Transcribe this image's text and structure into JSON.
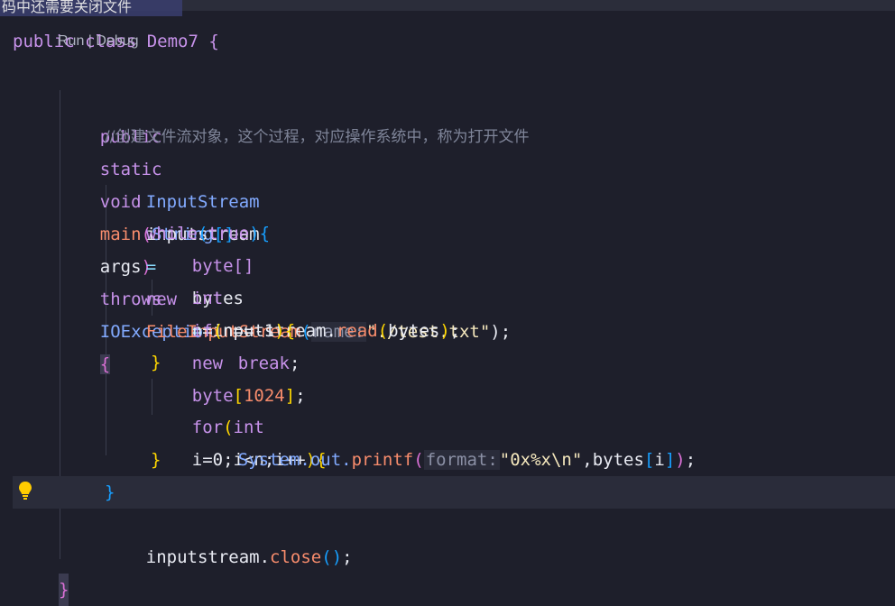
{
  "header_strip_text": "码中还需要关闭文件",
  "class_line": "public class Demo7 {",
  "codelens": "Run | Debug",
  "lines": {
    "main_sig": {
      "kw1": "public",
      "kw2": "static",
      "kw3": "void",
      "fn": "main",
      "type": "String",
      "brk": "[]",
      "arg": "args",
      "throws": "throws",
      "exc": "IOException",
      "brace": "{"
    },
    "comment": "//创建文件流对象，这个过程，对应操作系统中，称为打开文件",
    "decl": {
      "type": "InputStream",
      "var": "inputstream",
      "eq": "=",
      "new": "new",
      "ctor": "FileInputStream",
      "hint": "name:",
      "str": "\"./test.txt\"",
      "end": ");"
    },
    "while": {
      "kw": "while",
      "cond": "true",
      "brace": "{"
    },
    "bytes": {
      "type": "byte[]",
      "var": "bytes",
      "eq": "=",
      "new": "new",
      "t2": "byte",
      "num": "1024",
      "end": ";"
    },
    "read": {
      "type": "int",
      "expr": "n=inputstream.",
      "fn": "read",
      "arg": "bytes",
      "end": ";"
    },
    "if": {
      "kw": "if",
      "cond": "n==-1",
      "brace": "{"
    },
    "break": {
      "kw": "break",
      "end": ";"
    },
    "if_close": "}",
    "for": {
      "kw": "for",
      "type": "int",
      "cond": "i=0;i<n;i++",
      "brace": "{"
    },
    "printf": {
      "obj": "System.out.",
      "fn": "printf",
      "hint": "format:",
      "str": "\"0x%x\\n\"",
      "arg": ",bytes",
      "idx": "i",
      "end": ";"
    },
    "for_close": "}",
    "while_close": "}",
    "close": {
      "obj": "inputstream.",
      "fn": "close",
      "end": ";"
    },
    "main_close": "}"
  },
  "icons": {
    "bulb": "lightbulb-icon"
  },
  "colors": {
    "background": "#1e1f2b",
    "keyword": "#c792ea",
    "type": "#82aaff",
    "function": "#f78c6c",
    "string": "#f5e8bd"
  }
}
